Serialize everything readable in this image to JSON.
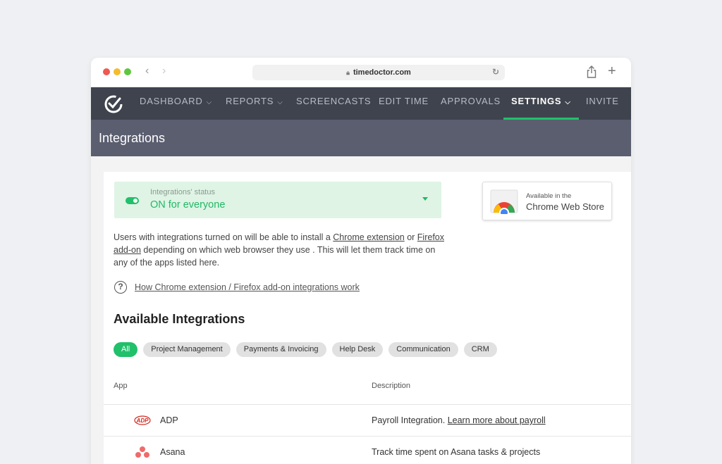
{
  "browser": {
    "url": "timedoctor.com",
    "icons": [
      "back-arrow-icon",
      "forward-arrow-icon",
      "lock-icon",
      "reload-icon",
      "share-icon",
      "new-tab-icon"
    ]
  },
  "nav": {
    "items": [
      {
        "label": "DASHBOARD",
        "has_dropdown": true
      },
      {
        "label": "REPORTS",
        "has_dropdown": true
      },
      {
        "label": "SCREENCASTS",
        "has_dropdown": false
      },
      {
        "label": "EDIT TIME",
        "has_dropdown": false
      },
      {
        "label": "APPROVALS",
        "has_dropdown": false
      },
      {
        "label": "SETTINGS",
        "has_dropdown": true,
        "active": true
      },
      {
        "label": "INVITE",
        "has_dropdown": false
      }
    ],
    "accent": "#21c06b"
  },
  "page": {
    "title": "Integrations"
  },
  "status": {
    "label": "Integrations' status",
    "value": "ON for everyone"
  },
  "chrome_store": {
    "small": "Available in the",
    "big": "Chrome Web Store"
  },
  "description": {
    "part1": "Users with integrations turned on will be able to install a ",
    "link1": "Chrome extension",
    "part2": " or ",
    "link2": "Firefox add-on",
    "part3": " depending on which web browser they use . This will let them track time on any of the apps listed here."
  },
  "help": {
    "link": "How Chrome extension / Firefox add-on integrations work"
  },
  "integrations": {
    "title": "Available Integrations",
    "filters": [
      "All",
      "Project Management",
      "Payments & Invoicing",
      "Help Desk",
      "Communication",
      "CRM"
    ],
    "active_filter": "All",
    "columns": {
      "app": "App",
      "description": "Description"
    },
    "rows": [
      {
        "name": "ADP",
        "icon": "adp-logo-icon",
        "desc": "Payroll Integration. ",
        "link": "Learn more about payroll"
      },
      {
        "name": "Asana",
        "icon": "asana-logo-icon",
        "desc": "Track time spent on Asana tasks & projects",
        "link": ""
      }
    ]
  }
}
